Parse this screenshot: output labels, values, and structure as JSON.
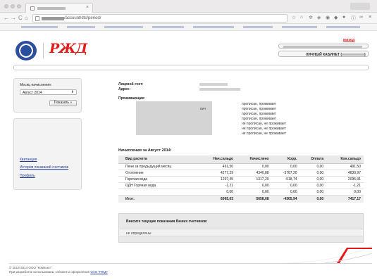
{
  "browser": {
    "url": "/account/dts/period/",
    "tab_close": "×",
    "back_glyph": "←",
    "forward_glyph": "→",
    "reload_glyph": "C",
    "home_glyph": "⌂"
  },
  "header": {
    "logo_text": "РЖД",
    "exit_label": "выход",
    "cabinet_label": "ЛИЧНЫЙ КАБИНЕТ (",
    "cabinet_close": ")"
  },
  "sidebar": {
    "month_label": "Месяц начисления:",
    "month_value": "Август 2014",
    "month_arrow": "⬍",
    "show_button": "Показать",
    "show_arrow": "»",
    "links": [
      "Квитанция",
      "История показаний счетчиков",
      "Профиль"
    ]
  },
  "account": {
    "account_label": "Лицевой счет:",
    "address_label": "Адрес:",
    "residents_label": "Проживающие:",
    "resident_fragment": "вич",
    "statuses": [
      "прописан, проживает",
      "прописан, проживает",
      "прописан, проживает",
      "прописан, проживает",
      "не прописан, не проживает",
      "не прописан, не проживает",
      "не прописан, не проживает"
    ]
  },
  "charges": {
    "title": "Начисления за Август 2014:",
    "columns": [
      "Вид расчета",
      "Нач.сальдо",
      "Начислено",
      "Корр.",
      "Оплата",
      "Кон.сальдо"
    ],
    "rows": [
      [
        "Пени за предыдущий месяц",
        "491,50",
        "0,00",
        "0,00",
        "0,00",
        "491,50"
      ],
      [
        "Отопление",
        "4277,29",
        "4340,88",
        "-3787,20",
        "0,00",
        "4830,97"
      ],
      [
        "Горячая вода",
        "1297,45",
        "1317,20",
        "-518,74",
        "0,00",
        "2095,91"
      ],
      [
        "ОДН Горячая вода",
        "-1,21",
        "0,00",
        "0,00",
        "0,00",
        "-1,21"
      ],
      [
        "",
        "0,00",
        "0,00",
        "0,00",
        "0,00",
        "0,00"
      ]
    ],
    "total": [
      "Итог:",
      "6065,03",
      "5658,08",
      "-4305,94",
      "0,00",
      "7417,17"
    ]
  },
  "meters": {
    "title": "Внесите текущие показания Ваших счетчиков:",
    "value": "не определены"
  },
  "footer": {
    "copyright": "© 2013-2014 ООО \"Компьют\"",
    "credit": "При разработке использованы элементы оформления",
    "credit_link": "ОАО \"РЖД\""
  },
  "colors": {
    "brand_red": "#e21a1a",
    "link_blue": "#223b9a",
    "emblem_blue": "#2b4f9e"
  }
}
